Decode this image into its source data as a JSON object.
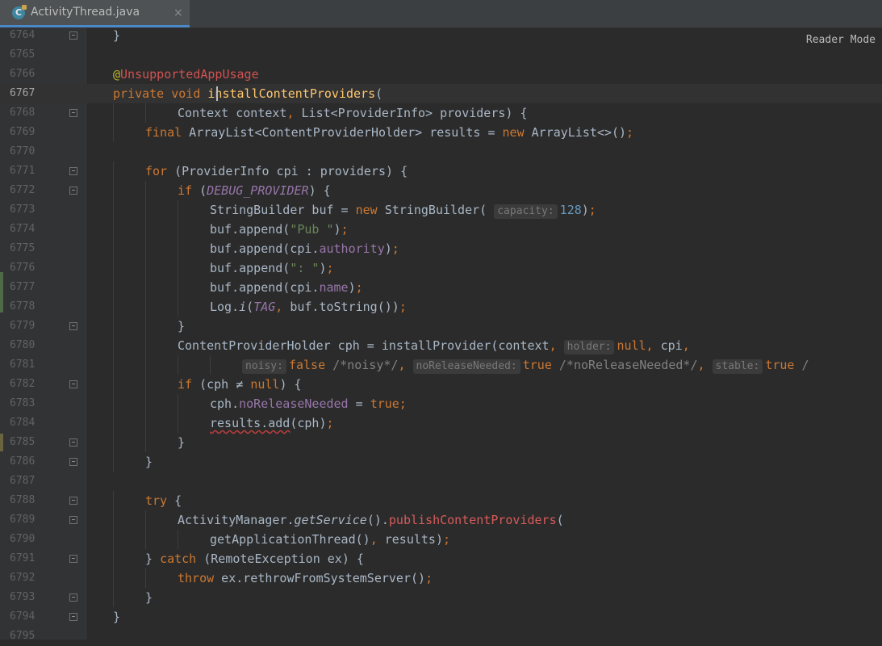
{
  "tab": {
    "icon": "C",
    "title": "ActivityThread.java",
    "close": "×"
  },
  "reader_mode": "Reader Mode",
  "lines": [
    {
      "num": "6764",
      "fold": true,
      "indent": 0,
      "html": "}"
    },
    {
      "num": "6765",
      "fold": false,
      "indent": 0,
      "html": ""
    },
    {
      "num": "6766",
      "fold": false,
      "indent": 0,
      "html": "<span class='ann'>@</span><span class='ann-err'>UnsupportedAppUsage</span>"
    },
    {
      "num": "6767",
      "fold": false,
      "indent": 0,
      "current": true,
      "html": "<span class='kw'>private</span> <span class='kw'>void</span> <span class='fn'>installContentProviders</span>("
    },
    {
      "num": "6768",
      "fold": true,
      "indent": 2,
      "html": "Context context<span class='kw'>,</span> List&lt;ProviderInfo&gt; providers) {"
    },
    {
      "num": "6769",
      "fold": false,
      "indent": 1,
      "html": "<span class='kw'>final</span> ArrayList&lt;ContentProviderHolder&gt; results = <span class='kw'>new</span> ArrayList&lt;&gt;()<span class='kw'>;</span>"
    },
    {
      "num": "6770",
      "fold": false,
      "indent": 0,
      "html": ""
    },
    {
      "num": "6771",
      "fold": true,
      "indent": 1,
      "html": "<span class='kw'>for</span> (ProviderInfo cpi : providers) {"
    },
    {
      "num": "6772",
      "fold": true,
      "indent": 2,
      "html": "<span class='kw'>if</span> (<span class='const'>DEBUG_PROVIDER</span>) {"
    },
    {
      "num": "6773",
      "fold": false,
      "indent": 3,
      "html": "StringBuilder buf = <span class='kw'>new</span> StringBuilder( <span class='hint'>capacity:</span><span class='num'>128</span>)<span class='kw'>;</span>"
    },
    {
      "num": "6774",
      "fold": false,
      "indent": 3,
      "html": "buf.append(<span class='str'>\"Pub \"</span>)<span class='kw'>;</span>"
    },
    {
      "num": "6775",
      "fold": false,
      "indent": 3,
      "html": "buf.append(cpi.<span class='field'>authority</span>)<span class='kw'>;</span>"
    },
    {
      "num": "6776",
      "fold": false,
      "indent": 3,
      "html": "buf.append(<span class='str'>\": \"</span>)<span class='kw'>;</span>"
    },
    {
      "num": "6777",
      "fold": false,
      "indent": 3,
      "html": "buf.append(cpi.<span class='field'>name</span>)<span class='kw'>;</span>"
    },
    {
      "num": "6778",
      "fold": false,
      "indent": 3,
      "html": "Log.<span class='stat'>i</span>(<span class='const'>TAG</span><span class='kw'>,</span> buf.toString())<span class='kw'>;</span>"
    },
    {
      "num": "6779",
      "fold": true,
      "indent": 2,
      "html": "}"
    },
    {
      "num": "6780",
      "fold": false,
      "indent": 2,
      "html": "ContentProviderHolder cph = installProvider(context<span class='kw'>,</span> <span class='hint'>holder:</span><span class='kw'>null,</span> cpi<span class='kw'>,</span>"
    },
    {
      "num": "6781",
      "fold": false,
      "indent": 4,
      "html": "<span class='hint'>noisy:</span><span class='kw'>false</span> <span class='cmt'>/*noisy*/</span><span class='kw'>,</span> <span class='hint'>noReleaseNeeded:</span><span class='kw'>true</span> <span class='cmt'>/*noReleaseNeeded*/</span><span class='kw'>,</span> <span class='hint'>stable:</span><span class='kw'>true</span> <span class='cmt'>/</span>"
    },
    {
      "num": "6782",
      "fold": true,
      "indent": 2,
      "html": "<span class='kw'>if</span> (cph ≠ <span class='kw'>null</span>) {"
    },
    {
      "num": "6783",
      "fold": false,
      "indent": 3,
      "html": "cph.<span class='field'>noReleaseNeeded</span> = <span class='kw'>true;</span>"
    },
    {
      "num": "6784",
      "fold": false,
      "indent": 3,
      "html": "<span class='wavy'>results.add</span>(cph)<span class='kw'>;</span>"
    },
    {
      "num": "6785",
      "fold": true,
      "indent": 2,
      "html": "}"
    },
    {
      "num": "6786",
      "fold": true,
      "indent": 1,
      "html": "}"
    },
    {
      "num": "6787",
      "fold": false,
      "indent": 0,
      "html": ""
    },
    {
      "num": "6788",
      "fold": true,
      "indent": 1,
      "html": "<span class='kw'>try</span> {"
    },
    {
      "num": "6789",
      "fold": true,
      "indent": 2,
      "html": "ActivityManager.<span class='stat'>getService</span>().<span class='inmethod'>publishContentProviders</span>("
    },
    {
      "num": "6790",
      "fold": false,
      "indent": 3,
      "html": "getApplicationThread()<span class='kw'>,</span> results)<span class='kw'>;</span>"
    },
    {
      "num": "6791",
      "fold": true,
      "indent": 1,
      "html": "} <span class='kw'>catch</span> (RemoteException ex) {"
    },
    {
      "num": "6792",
      "fold": false,
      "indent": 2,
      "html": "<span class='kw'>throw</span> ex.rethrowFromSystemServer()<span class='kw'>;</span>"
    },
    {
      "num": "6793",
      "fold": true,
      "indent": 1,
      "html": "}"
    },
    {
      "num": "6794",
      "fold": true,
      "indent": 0,
      "html": "}"
    },
    {
      "num": "6795",
      "fold": false,
      "indent": 0,
      "html": ""
    }
  ]
}
